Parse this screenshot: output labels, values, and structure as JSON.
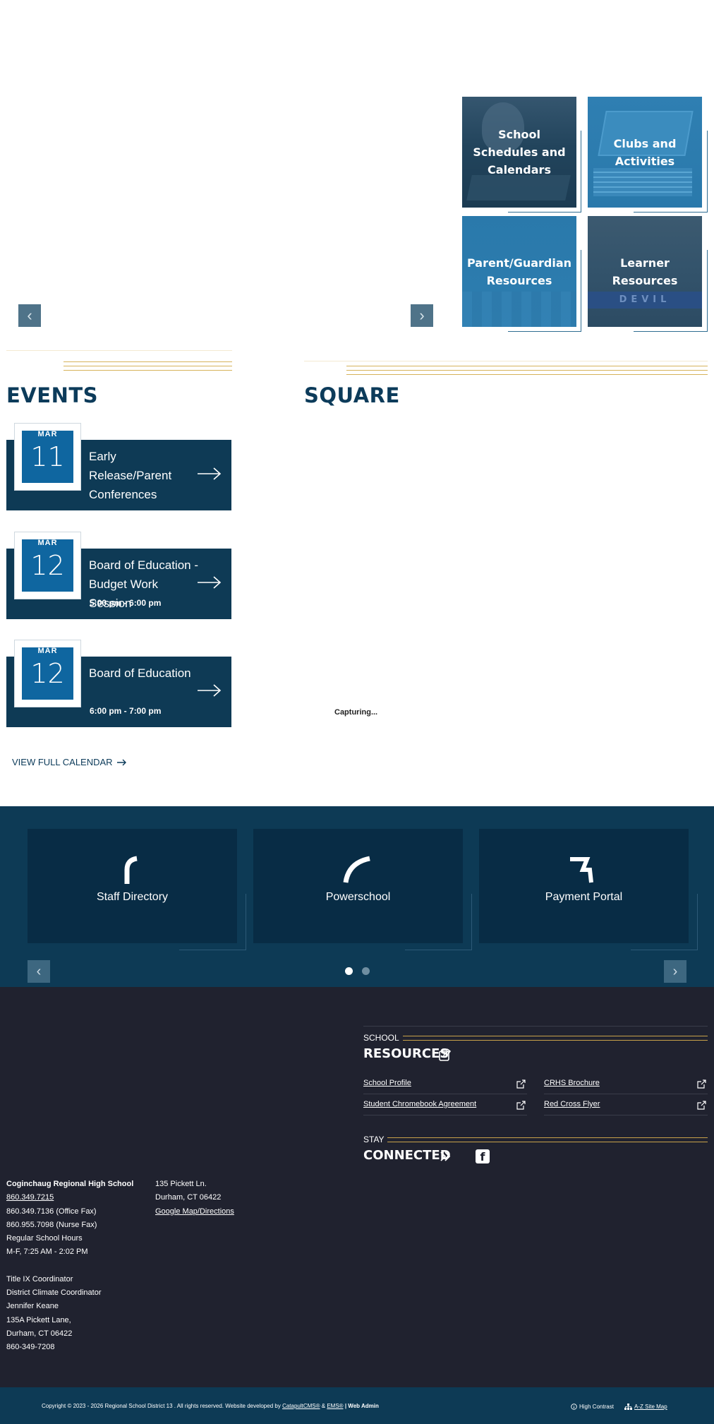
{
  "hero": {
    "prev_label": "‹",
    "next_label": "›"
  },
  "tiles": [
    {
      "label": "School Schedules and Calendars"
    },
    {
      "label": "Clubs and Activities"
    },
    {
      "label": "Parent/Guardian Resources"
    },
    {
      "label": "Learner Resources"
    }
  ],
  "events": {
    "title": "EVENTS",
    "items": [
      {
        "month": "MAR",
        "day": "11",
        "title": "Early Release/Parent Conferences",
        "time": ""
      },
      {
        "month": "MAR",
        "day": "12",
        "title": "Board of Education - Budget Work Session",
        "time": "5:00 pm - 6:00 pm"
      },
      {
        "month": "MAR",
        "day": "12",
        "title": "Board of Education",
        "time": "6:00 pm - 7:00 pm"
      }
    ],
    "view_all": "VIEW FULL CALENDAR"
  },
  "square": {
    "title": "SQUARE",
    "status": "Capturing..."
  },
  "quick_links": {
    "items": [
      {
        "label": "Staff Directory"
      },
      {
        "label": "Powerschool"
      },
      {
        "label": "Payment Portal"
      }
    ],
    "active_page": 1,
    "page_count": 2
  },
  "resources": {
    "small": "SCHOOL",
    "big": "RESOURCES",
    "links": [
      {
        "label": "School Profile"
      },
      {
        "label": "CRHS Brochure"
      },
      {
        "label": "Student Chromebook Agreement"
      },
      {
        "label": "Red Cross Flyer"
      }
    ]
  },
  "connected": {
    "small": "STAY",
    "big": "CONNECTED",
    "social_icon": "facebook-icon"
  },
  "contact": {
    "school_name": "Coginchaug Regional High School",
    "phone": "860.349.7215",
    "office_fax": "860.349.7136 (Office Fax)",
    "nurse_fax": "860.955.7098 (Nurse Fax)",
    "hours_label": "Regular School Hours",
    "hours": "M-F, 7:25 AM - 2:02 PM",
    "address_line1": "135 Pickett Ln.",
    "address_line2": "Durham, CT 06422",
    "map_link": "Google Map/Directions",
    "title_ix": "Title IX Coordinator",
    "climate": "District Climate Coordinator",
    "coordinator_name": "Jennifer Keane",
    "coordinator_addr1": "135A Pickett Lane,",
    "coordinator_addr2": "Durham, CT 06422",
    "coordinator_phone": "860-349-7208"
  },
  "footer_bar": {
    "copyright": "Copyright © 2023 - 2026 Regional School District 13 . All rights reserved. Website developed by",
    "cms": "CatapultCMS®",
    "amp": "&",
    "ems": "EMS®",
    "sep": "|",
    "admin": "Web Admin",
    "high_contrast": "High Contrast",
    "site_map": "A-Z Site Map"
  },
  "colors": {
    "navy": "#0d3a55",
    "accent_blue": "#0f66a0",
    "gold": "#d6b25a",
    "footer_bg": "#20222f"
  }
}
